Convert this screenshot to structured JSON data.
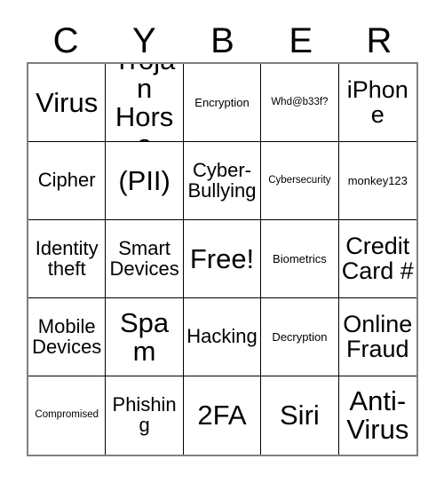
{
  "card": {
    "title_letters": [
      "C",
      "Y",
      "B",
      "E",
      "R"
    ],
    "rows": [
      [
        {
          "label": "Virus",
          "size": "xl"
        },
        {
          "label": "Trojan Horse",
          "size": "xl"
        },
        {
          "label": "Encryption",
          "size": "xs"
        },
        {
          "label": "Whd@b33f?",
          "size": "xxs"
        },
        {
          "label": "iPhone",
          "size": "lg"
        }
      ],
      [
        {
          "label": "Cipher",
          "size": "md"
        },
        {
          "label": "(PII)",
          "size": "xl"
        },
        {
          "label": "Cyber-Bullying",
          "size": "md"
        },
        {
          "label": "Cybersecurity",
          "size": "xxs"
        },
        {
          "label": "monkey123",
          "size": "xs"
        }
      ],
      [
        {
          "label": "Identity theft",
          "size": "md"
        },
        {
          "label": "Smart Devices",
          "size": "md"
        },
        {
          "label": "Free!",
          "size": "xl"
        },
        {
          "label": "Biometrics",
          "size": "xs"
        },
        {
          "label": "Credit Card #",
          "size": "lg"
        }
      ],
      [
        {
          "label": "Mobile Devices",
          "size": "md"
        },
        {
          "label": "Spam",
          "size": "xl"
        },
        {
          "label": "Hacking",
          "size": "md"
        },
        {
          "label": "Decryption",
          "size": "xs"
        },
        {
          "label": "Online Fraud",
          "size": "lg"
        }
      ],
      [
        {
          "label": "Compromised",
          "size": "xxs"
        },
        {
          "label": "Phishing",
          "size": "md"
        },
        {
          "label": "2FA",
          "size": "xl"
        },
        {
          "label": "Siri",
          "size": "xl"
        },
        {
          "label": "Anti-Virus",
          "size": "xl"
        }
      ]
    ],
    "free_space_label": "Free!",
    "colors": {
      "text": "#000000",
      "cell_border": "#000000",
      "outer_border": "#808080",
      "background": "#ffffff"
    }
  }
}
